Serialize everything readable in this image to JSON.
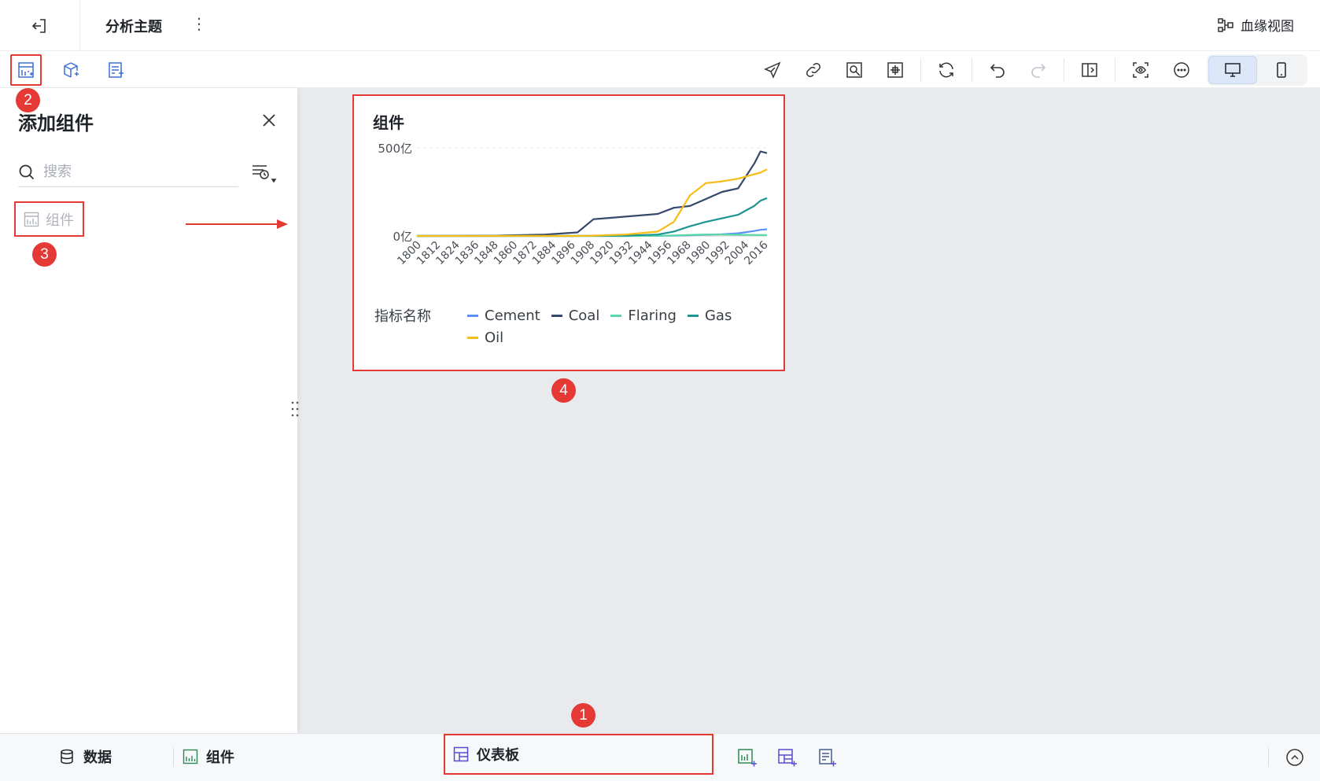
{
  "header": {
    "title": "分析主题",
    "lineage_label": "血缘视图"
  },
  "panel": {
    "title": "添加组件",
    "search_placeholder": "搜索",
    "item_label": "组件"
  },
  "widget": {
    "title": "组件",
    "legend_title": "指标名称"
  },
  "chart_data": {
    "type": "line",
    "title": "组件",
    "xlabel": "",
    "ylabel": "",
    "y_ticks": [
      "0亿",
      "500亿"
    ],
    "ylim": [
      0,
      500
    ],
    "x_ticks": [
      "1800",
      "1812",
      "1824",
      "1836",
      "1848",
      "1860",
      "1872",
      "1884",
      "1896",
      "1908",
      "1920",
      "1932",
      "1944",
      "1956",
      "1968",
      "1980",
      "1992",
      "2004",
      "2016"
    ],
    "x": [
      1800,
      1850,
      1880,
      1900,
      1910,
      1930,
      1950,
      1960,
      1970,
      1980,
      1990,
      2000,
      2010,
      2014,
      2018
    ],
    "legend_title": "指标名称",
    "legend_position": "bottom",
    "grid": "horizontal dashed",
    "series": [
      {
        "name": "Cement",
        "color": "#5b8ff9",
        "values": [
          0,
          0,
          0,
          0,
          0,
          0,
          1,
          2,
          4,
          7,
          10,
          15,
          28,
          35,
          38
        ]
      },
      {
        "name": "Coal",
        "color": "#36486b",
        "values": [
          0,
          2,
          8,
          20,
          95,
          110,
          125,
          160,
          170,
          210,
          250,
          270,
          410,
          480,
          470
        ]
      },
      {
        "name": "Flaring",
        "color": "#5ad8a6",
        "values": [
          0,
          0,
          0,
          0,
          0,
          0,
          1,
          3,
          6,
          8,
          8,
          7,
          6,
          5,
          5
        ]
      },
      {
        "name": "Gas",
        "color": "#1e9493",
        "values": [
          0,
          0,
          0,
          0,
          1,
          2,
          8,
          25,
          55,
          80,
          100,
          120,
          170,
          200,
          215
        ]
      },
      {
        "name": "Oil",
        "color": "#f6bd16",
        "values": [
          0,
          0,
          0,
          0,
          2,
          8,
          25,
          80,
          230,
          300,
          310,
          325,
          350,
          360,
          378
        ]
      }
    ]
  },
  "bottom": {
    "data_label": "数据",
    "component_label": "组件",
    "dashboard_label": "仪表板"
  },
  "badges": {
    "b1": "1",
    "b2": "2",
    "b3": "3",
    "b4": "4"
  }
}
